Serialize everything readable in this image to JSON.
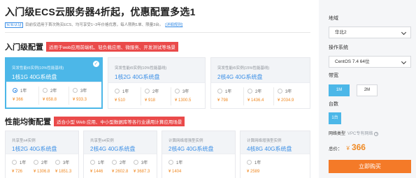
{
  "header": {
    "title": "入门级ECS云服务器4折起，优惠配置多选1",
    "tag": "实名认证",
    "notice": "目前仅适用于首次购买ECS、均可享受1~3年价格优惠，每人限购1单、限量3台。",
    "rules_link": "[详细规则]"
  },
  "section_entry": {
    "title": "入门级配置",
    "highlight": "适用于web应用前端机、轻负载应用、微服务、开发测试等场景",
    "cards": [
      {
        "type": "突发性能t5实例(10%性能基线)",
        "spec": "1核1G 40G系统盘",
        "selected": true,
        "options": [
          {
            "label": "1年",
            "price": "¥ 366",
            "selected": true
          },
          {
            "label": "2年",
            "price": "¥ 658.8",
            "selected": false
          },
          {
            "label": "3年",
            "price": "¥ 933.3",
            "selected": false
          }
        ]
      },
      {
        "type": "突发性能t5实例(10%性能基线)",
        "spec": "1核2G 40G系统盘",
        "selected": false,
        "options": [
          {
            "label": "1年",
            "price": "¥ 510",
            "selected": false
          },
          {
            "label": "2年",
            "price": "¥ 918",
            "selected": false
          },
          {
            "label": "3年",
            "price": "¥ 1300.5",
            "selected": false
          }
        ]
      },
      {
        "type": "突发性能t5实例(15%性能基线)",
        "spec": "2核4G 40G系统盘",
        "selected": false,
        "options": [
          {
            "label": "1年",
            "price": "¥ 798",
            "selected": false
          },
          {
            "label": "2年",
            "price": "¥ 1436.4",
            "selected": false
          },
          {
            "label": "3年",
            "price": "¥ 2034.9",
            "selected": false
          }
        ]
      }
    ]
  },
  "section_balanced": {
    "title": "性能均衡配置",
    "highlight": "适合小型 Web 应用、中小型数据库等各行业通用计算应用场景",
    "cards": [
      {
        "type": "共享型n4实例",
        "spec": "1核2G 40G系统盘",
        "options": [
          {
            "label": "1年",
            "price": "¥ 726",
            "selected": false
          },
          {
            "label": "2年",
            "price": "¥ 1306.8",
            "selected": false
          },
          {
            "label": "3年",
            "price": "¥ 1851.3",
            "selected": false
          }
        ]
      },
      {
        "type": "共享型n4实例",
        "spec": "2核4G 40G系统盘",
        "options": [
          {
            "label": "1年",
            "price": "¥ 1446",
            "selected": false
          },
          {
            "label": "2年",
            "price": "¥ 2602.8",
            "selected": false
          },
          {
            "label": "3年",
            "price": "¥ 3687.3",
            "selected": false
          }
        ]
      },
      {
        "type": "计算网络增强型实例",
        "spec": "2核4G 40G系统盘",
        "options": [
          {
            "label": "1年",
            "price": "¥ 1404",
            "selected": false
          }
        ]
      },
      {
        "type": "计算网络增强型实例",
        "spec": "4核8G 40G系统盘",
        "options": [
          {
            "label": "1年",
            "price": "¥ 2589",
            "selected": false
          }
        ]
      }
    ]
  },
  "sidebar": {
    "region_label": "地域",
    "region_value": "华北2",
    "os_label": "操作系统",
    "os_value": "CentOS 7.4 64位",
    "bandwidth_label": "带宽",
    "bandwidth_options": [
      {
        "label": "1M",
        "selected": true
      },
      {
        "label": "2M",
        "selected": false
      }
    ],
    "count_label": "台数",
    "count_value": "1台",
    "network_label": "网络类型",
    "network_value": "VPC专有网络",
    "network_help": "?",
    "total_label": "总价：",
    "total_currency": "¥",
    "total_amount": "366",
    "buy_label": "立即购买"
  },
  "colors": {
    "accent": "#4cb7e8",
    "link": "#3a8ee6",
    "price": "#f08a24",
    "highlight_bg": "#ea4a4a",
    "buy_button": "#f47a28"
  }
}
